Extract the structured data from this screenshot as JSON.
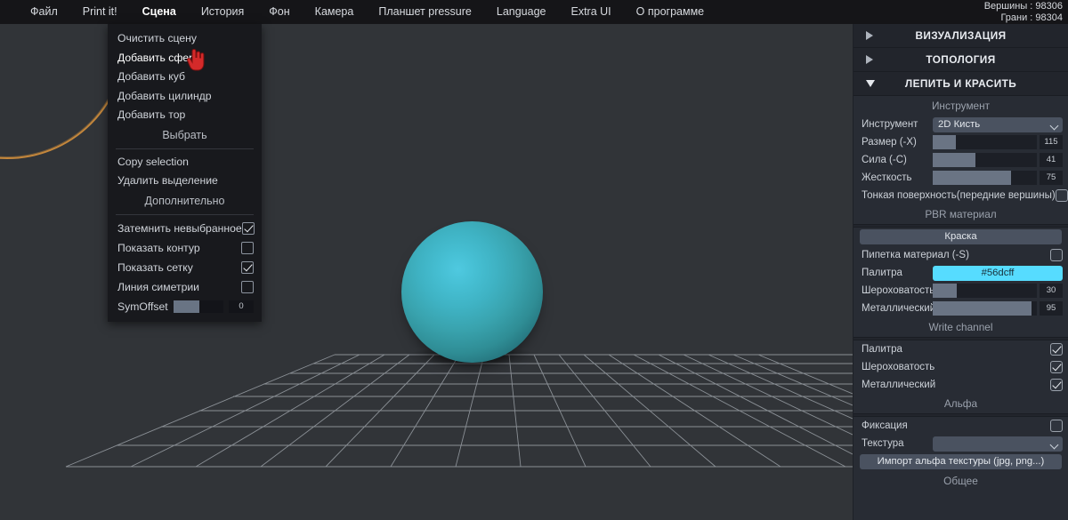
{
  "menubar": {
    "items": [
      {
        "label": "Файл",
        "active": false
      },
      {
        "label": "Print it!",
        "active": false
      },
      {
        "label": "Сцена",
        "active": true
      },
      {
        "label": "История",
        "active": false
      },
      {
        "label": "Фон",
        "active": false
      },
      {
        "label": "Камера",
        "active": false
      },
      {
        "label": "Планшет pressure",
        "active": false
      },
      {
        "label": "Language",
        "active": false
      },
      {
        "label": "Extra UI",
        "active": false
      },
      {
        "label": "О программе",
        "active": false
      }
    ]
  },
  "stats": {
    "vertices": "Вершины : 98306",
    "faces": "Грани : 98304"
  },
  "dropdown": {
    "items": [
      {
        "label": "Очистить сцену",
        "hovered": false
      },
      {
        "label": "Добавить сферу",
        "hovered": true
      },
      {
        "label": "Добавить куб",
        "hovered": false
      },
      {
        "label": "Добавить цилиндр",
        "hovered": false
      },
      {
        "label": "Добавить тор",
        "hovered": false
      }
    ],
    "select_title": "Выбрать",
    "select_items": [
      {
        "label": "Copy selection"
      },
      {
        "label": "Удалить выделение"
      }
    ],
    "extra_title": "Дополнительно",
    "checks": [
      {
        "label": "Затемнить невыбранное",
        "checked": true
      },
      {
        "label": "Показать контур",
        "checked": false
      },
      {
        "label": "Показать сетку",
        "checked": true
      },
      {
        "label": "Линия симетрии",
        "checked": false
      }
    ],
    "symoffset": {
      "label": "SymOffset",
      "value": "0",
      "fill_pct": 52
    }
  },
  "sidebar": {
    "sections": [
      {
        "title": "ВИЗУАЛИЗАЦИЯ",
        "expanded": false
      },
      {
        "title": "ТОПОЛОГИЯ",
        "expanded": false
      },
      {
        "title": "ЛЕПИТЬ И КРАСИТЬ",
        "expanded": true
      }
    ],
    "tool_group": {
      "heading": "Инструмент",
      "tool_label": "Инструмент",
      "tool_value": "2D Кисть",
      "sliders": [
        {
          "label": "Размер (-X)",
          "value": "115",
          "fill_pct": 22
        },
        {
          "label": "Сила (-С)",
          "value": "41",
          "fill_pct": 41
        },
        {
          "label": "Жесткость",
          "value": "75",
          "fill_pct": 75
        }
      ],
      "thin_surface": {
        "label": "Тонкая поверхность(передние вершины)",
        "checked": false
      }
    },
    "pbr_heading": "PBR материал",
    "paint_group": {
      "paint_button": "Краска",
      "picker": {
        "label": "Пипетка материал (-S)",
        "checked": false
      },
      "palette": {
        "label": "Палитра",
        "value": "#56dcff",
        "color": "#56dcff"
      },
      "sliders": [
        {
          "label": "Шероховатость",
          "value": "30",
          "fill_pct": 23
        },
        {
          "label": "Металлический",
          "value": "95",
          "fill_pct": 95
        }
      ]
    },
    "write_channel": {
      "heading": "Write channel",
      "checks": [
        {
          "label": "Палитра",
          "checked": true
        },
        {
          "label": "Шероховатость",
          "checked": true
        },
        {
          "label": "Металлический",
          "checked": true
        }
      ]
    },
    "alpha": {
      "heading": "Альфа",
      "fixation": {
        "label": "Фиксация",
        "checked": false
      },
      "texture": {
        "label": "Текстура",
        "value": ""
      },
      "import_button": "Импорт альфа текстуры (jpg, png...)"
    },
    "general_heading": "Общее"
  },
  "viewport": {
    "object": "sphere",
    "sphere_color": "#3fb3c4",
    "background_color": "#313438",
    "grid_color": "#9aa0a6",
    "brush_cursor_color": "#c4873c"
  }
}
